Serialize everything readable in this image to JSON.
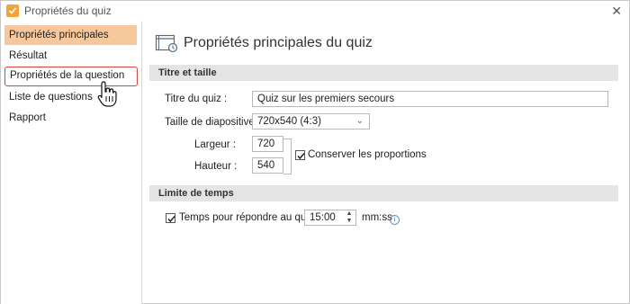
{
  "window": {
    "title": "Propriétés du quiz",
    "accent": "#f4a23a"
  },
  "sidebar": {
    "items": [
      {
        "label": "Propriétés principales",
        "state": "selected"
      },
      {
        "label": "Résultat"
      },
      {
        "label": "Propriétés de la question",
        "state": "highlighted"
      },
      {
        "label": "Liste de questions"
      },
      {
        "label": "Rapport"
      }
    ],
    "selected_color": "#f7c89b",
    "highlight_border_color": "#d9433b"
  },
  "main": {
    "title": "Propriétés principales du quiz",
    "sections": {
      "size": {
        "heading": "Titre et taille",
        "quiz_title_label": "Titre du quiz :",
        "quiz_title_value": "Quiz sur les premiers secours",
        "slide_size_label": "Taille de diapositive :",
        "slide_size_value": "720x540 (4:3)",
        "width_label": "Largeur :",
        "width_value": "720",
        "height_label": "Hauteur :",
        "height_value": "540",
        "keep_ratio_label": "Conserver les proportions",
        "keep_ratio_checked": true
      },
      "time": {
        "heading": "Limite de temps",
        "time_limit_label": "Temps pour répondre au quiz :",
        "time_limit_checked": true,
        "time_value": "15:00",
        "time_unit": "mm:ss"
      }
    }
  },
  "icons": {
    "close": "close-icon",
    "app": "quiz-app-icon",
    "header": "quiz-settings-icon",
    "cursor": "hand-pointer-icon",
    "info": "info-icon"
  }
}
